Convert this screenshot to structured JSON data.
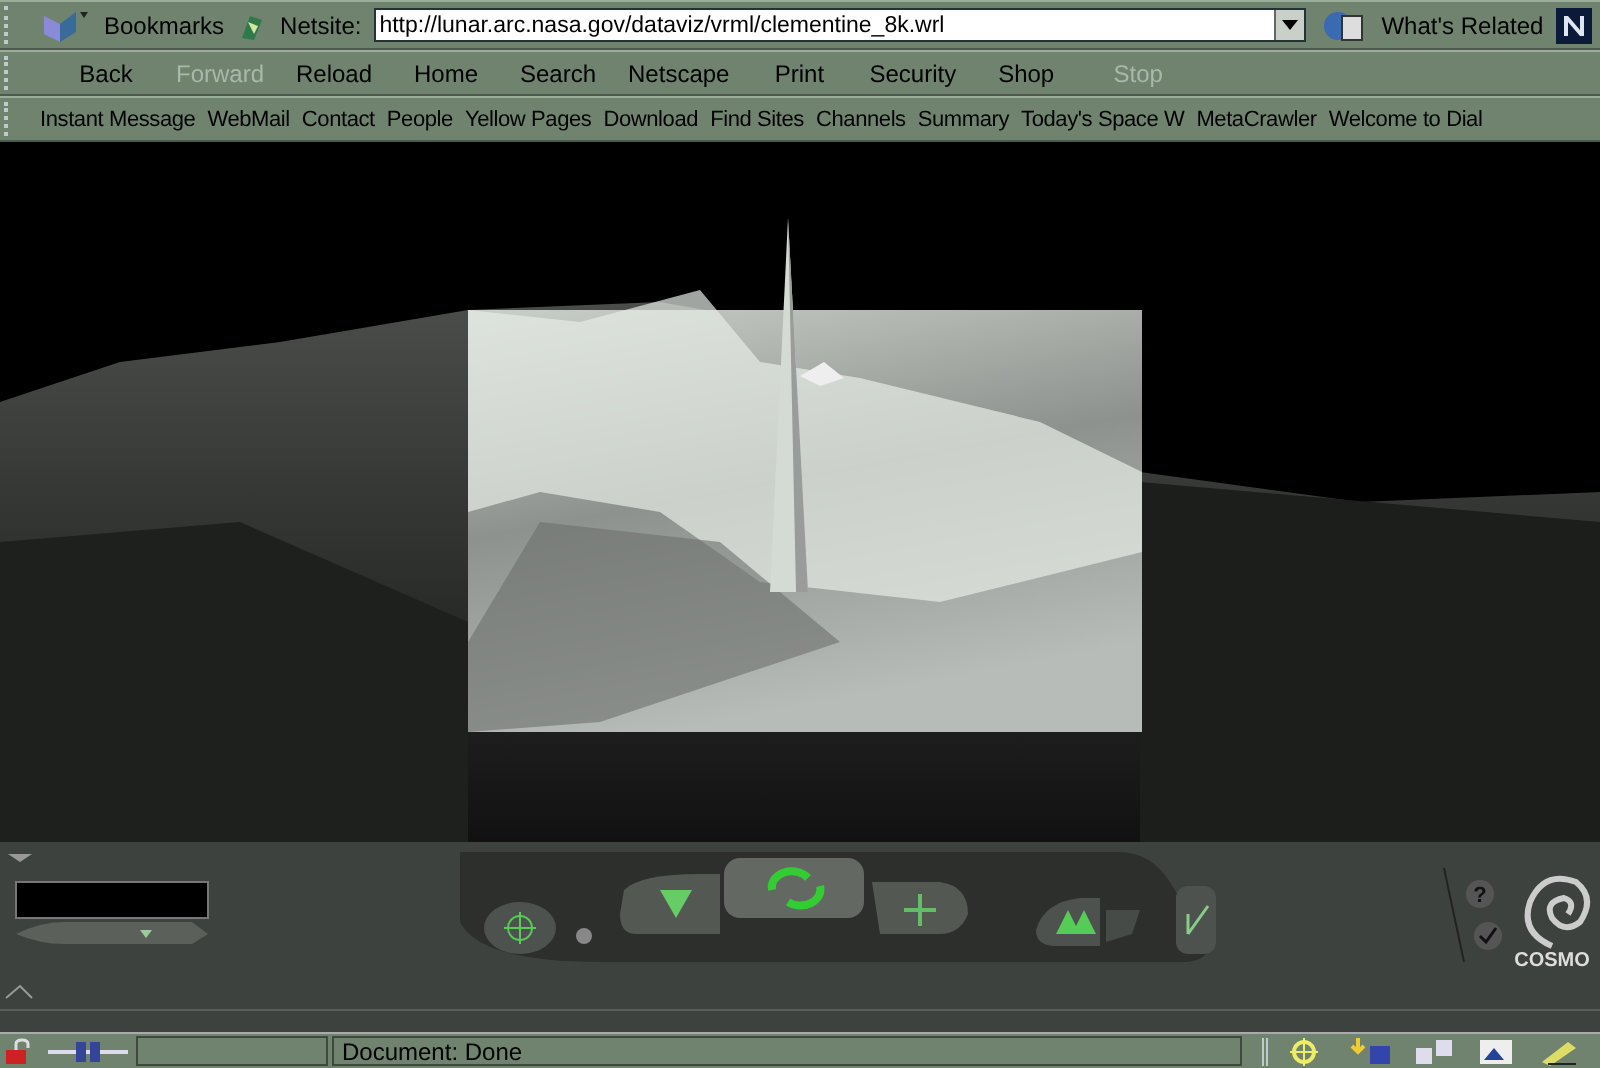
{
  "location_bar": {
    "bookmarks_label": "Bookmarks",
    "field_label": "Netsite:",
    "url": "http://lunar.arc.nasa.gov/dataviz/vrml/clementine_8k.wrl",
    "related_label": "What's Related"
  },
  "nav_buttons": [
    {
      "label": "Back",
      "disabled": false
    },
    {
      "label": "Forward",
      "disabled": true
    },
    {
      "label": "Reload",
      "disabled": false
    },
    {
      "label": "Home",
      "disabled": false
    },
    {
      "label": "Search",
      "disabled": false
    },
    {
      "label": "Netscape",
      "disabled": false
    },
    {
      "label": "Print",
      "disabled": false
    },
    {
      "label": "Security",
      "disabled": false
    },
    {
      "label": "Shop",
      "disabled": false
    },
    {
      "label": "Stop",
      "disabled": true
    }
  ],
  "personal_links": [
    "Instant Message",
    "WebMail",
    "Contact",
    "People",
    "Yellow Pages",
    "Download",
    "Find Sites",
    "Channels",
    "Summary",
    "Today's Space W",
    "MetaCrawler",
    "Welcome to Dial"
  ],
  "viewer": {
    "help_glyph": "?",
    "brand": "COSMO"
  },
  "status_bar": {
    "message": "Document: Done"
  }
}
